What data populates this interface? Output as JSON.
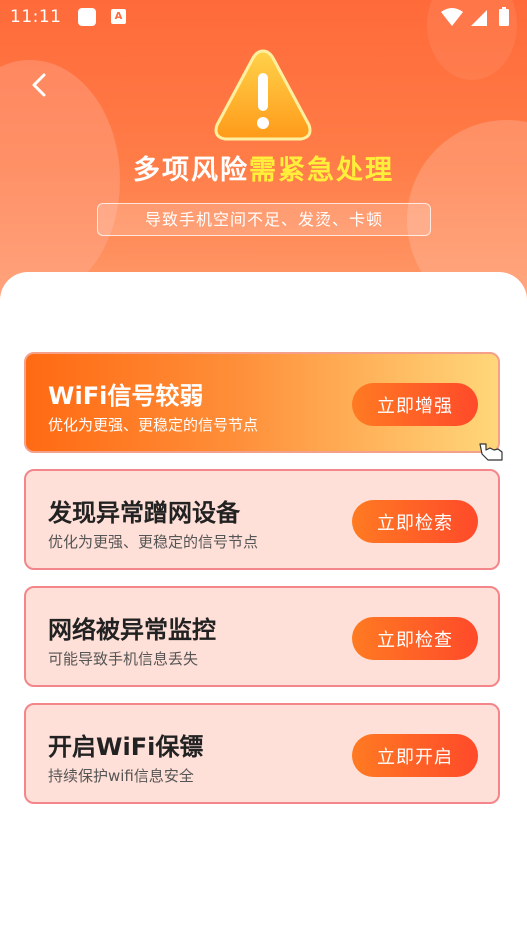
{
  "status_bar": {
    "time": "11:11"
  },
  "header": {
    "title_main": "多项风险",
    "title_highlight": "需紧急处理",
    "subtitle": "导致手机空间不足、发烫、卡顿"
  },
  "cards": [
    {
      "title": "WiFi信号较弱",
      "desc": "优化为更强、更稳定的信号节点",
      "button": "立即增强"
    },
    {
      "title": "发现异常蹭网设备",
      "desc": "优化为更强、更稳定的信号节点",
      "button": "立即检索"
    },
    {
      "title": "网络被异常监控",
      "desc": "可能导致手机信息丢失",
      "button": "立即检查"
    },
    {
      "title": "开启WiFi保镖",
      "desc": "持续保护wifi信息安全",
      "button": "立即开启"
    }
  ],
  "icons": {
    "back": "chevron-left-icon",
    "warning": "warning-triangle-icon",
    "wifi": "wifi-icon",
    "signal": "signal-icon",
    "battery": "battery-icon",
    "cursor": "pointer-cursor-icon"
  },
  "colors": {
    "header": "#ff6a3a",
    "highlight": "#ffef3a",
    "card_bg": "#ffe0d8",
    "card_border": "#f3868a",
    "button": "#ff5a26"
  }
}
